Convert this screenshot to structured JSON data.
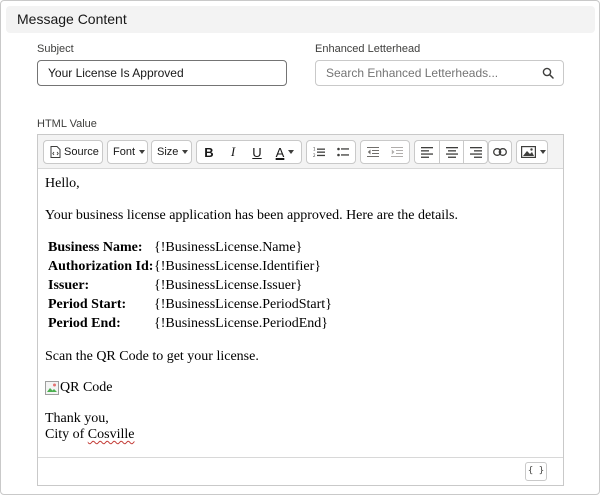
{
  "section": {
    "title": "Message Content"
  },
  "subject": {
    "label": "Subject",
    "value": "Your License Is Approved"
  },
  "letterhead": {
    "label": "Enhanced Letterhead",
    "placeholder": "Search Enhanced Letterheads..."
  },
  "html_value": {
    "label": "HTML Value"
  },
  "toolbar": {
    "source_label": "Source",
    "font_label": "Font",
    "size_label": "Size",
    "bold_label": "B",
    "italic_label": "I",
    "underline_label": "U",
    "text_color_label": "A"
  },
  "body": {
    "greeting": "Hello,",
    "intro": "Your business license application has been approved. Here are the details.",
    "details": [
      {
        "label": "Business Name:",
        "value": "{!BusinessLicense.Name}"
      },
      {
        "label": "Authorization Id:",
        "value": "{!BusinessLicense.Identifier}"
      },
      {
        "label": "Issuer:",
        "value": "{!BusinessLicense.Issuer}"
      },
      {
        "label": "Period Start:",
        "value": "{!BusinessLicense.PeriodStart}"
      },
      {
        "label": "Period End:",
        "value": "{!BusinessLicense.PeriodEnd}"
      }
    ],
    "scan_text": "Scan the QR Code to get your license.",
    "qr_alt": "QR Code",
    "thanks": "Thank you,",
    "sign_prefix": "City of ",
    "sign_city": "Cosville"
  },
  "merge_field_label": "{ }",
  "colors": {
    "header_bg": "#f3f3f3",
    "border": "#c9c9c9",
    "text": "#181818",
    "spell_error": "#c23934"
  }
}
